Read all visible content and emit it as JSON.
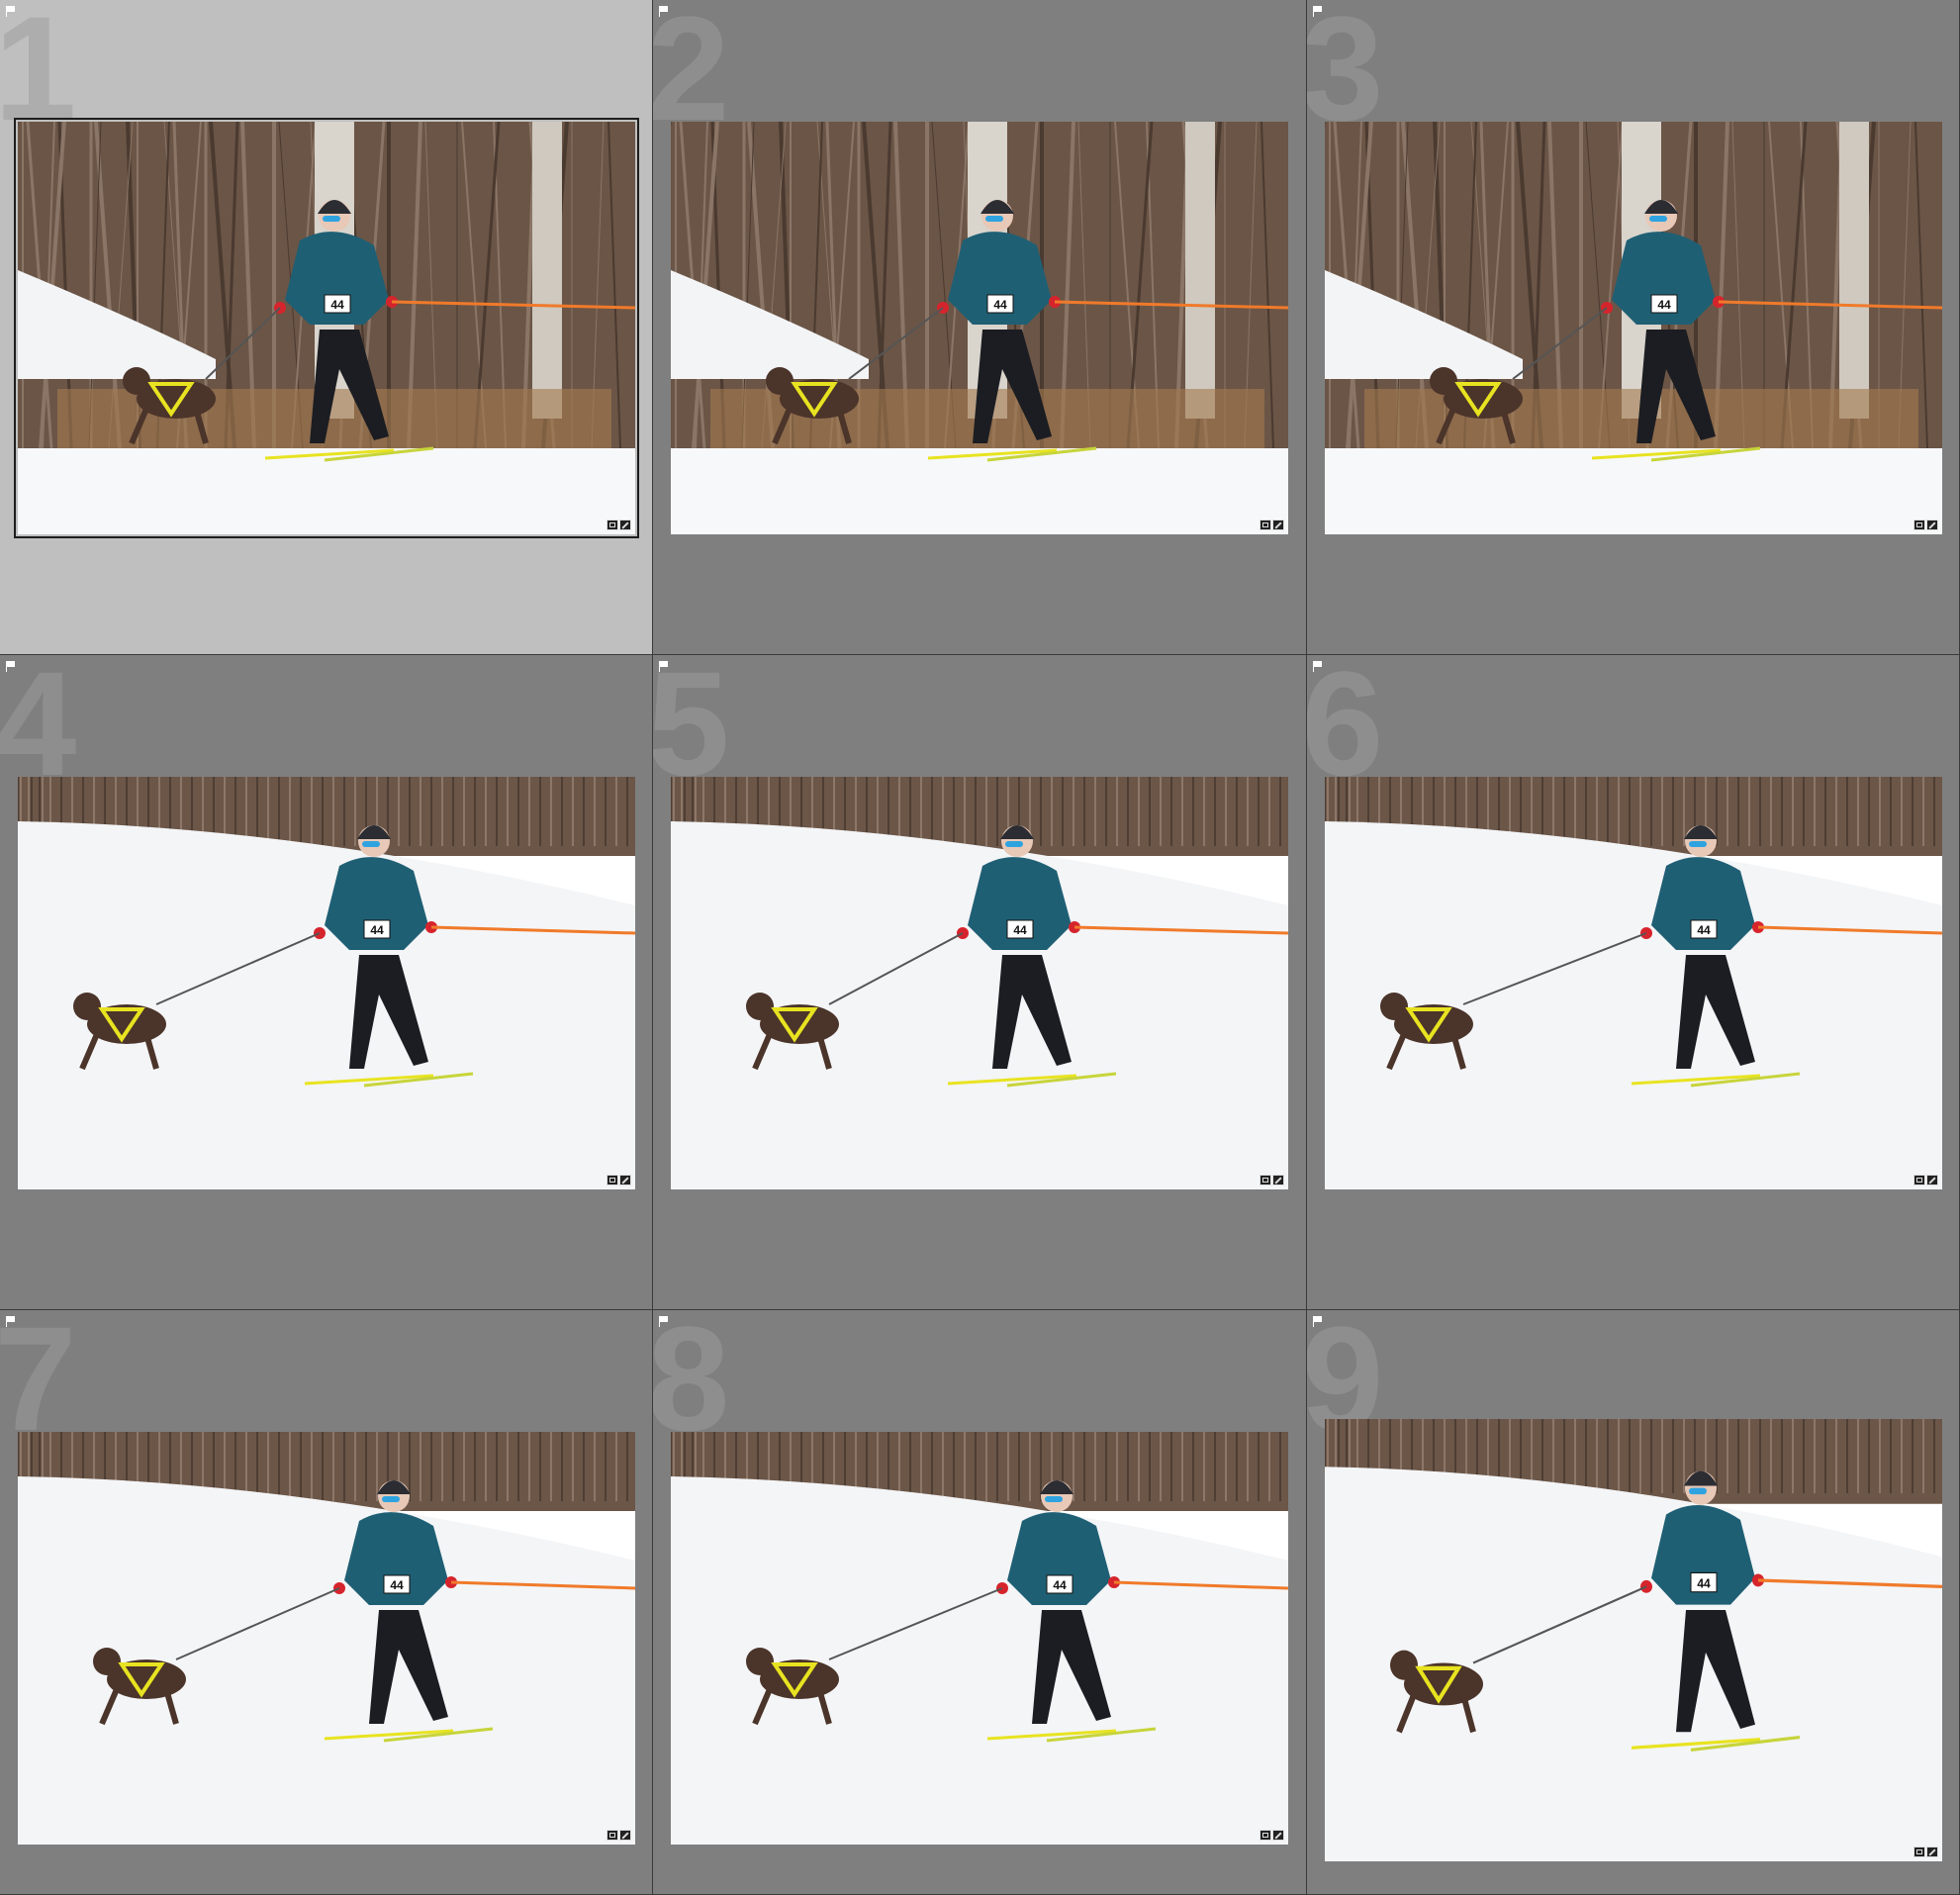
{
  "grid": {
    "cells": [
      {
        "index": "1",
        "bib": "44",
        "scene": "forest",
        "selected": true
      },
      {
        "index": "2",
        "bib": "44",
        "scene": "forest",
        "selected": false
      },
      {
        "index": "3",
        "bib": "44",
        "scene": "forest",
        "selected": false
      },
      {
        "index": "4",
        "bib": "44",
        "scene": "hill",
        "selected": false
      },
      {
        "index": "5",
        "bib": "44",
        "scene": "hill",
        "selected": false
      },
      {
        "index": "6",
        "bib": "44",
        "scene": "hill",
        "selected": false
      },
      {
        "index": "7",
        "bib": "44",
        "scene": "hill",
        "selected": false
      },
      {
        "index": "8",
        "bib": "44",
        "scene": "hill",
        "selected": false
      },
      {
        "index": "9",
        "bib": "44",
        "scene": "hill",
        "selected": false
      }
    ]
  },
  "icons": {
    "flag": "flag-icon",
    "crop_badge": "crop-badge-icon",
    "edit_badge": "edit-badge-icon"
  },
  "colors": {
    "selected_cell": "#bfbfbf",
    "cell": "#7f7f7f",
    "jacket": "#1f5f74",
    "leash": "#f07a2a",
    "harness": "#e8e320"
  }
}
